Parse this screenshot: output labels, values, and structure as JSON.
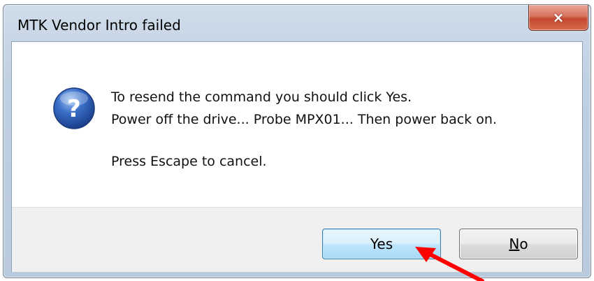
{
  "dialog": {
    "title": "MTK Vendor Intro failed",
    "close_symbol": "×",
    "icon": "question-icon",
    "message_lines": [
      "To resend the command you should click Yes.",
      "Power off the drive... Probe MPX01... Then power back on.",
      "Press Escape to cancel."
    ],
    "buttons": {
      "yes_label": "Yes",
      "no_mnemonic": "N",
      "no_rest": "o"
    }
  },
  "annotation": {
    "arrow_color": "#ff0000",
    "arrow_icon": "red-arrow-icon"
  },
  "colors": {
    "title_bar": "#bfd0e2",
    "close_button": "#c4482f",
    "default_button_border": "#3c7fb1",
    "footer": "#f0f0f0"
  }
}
